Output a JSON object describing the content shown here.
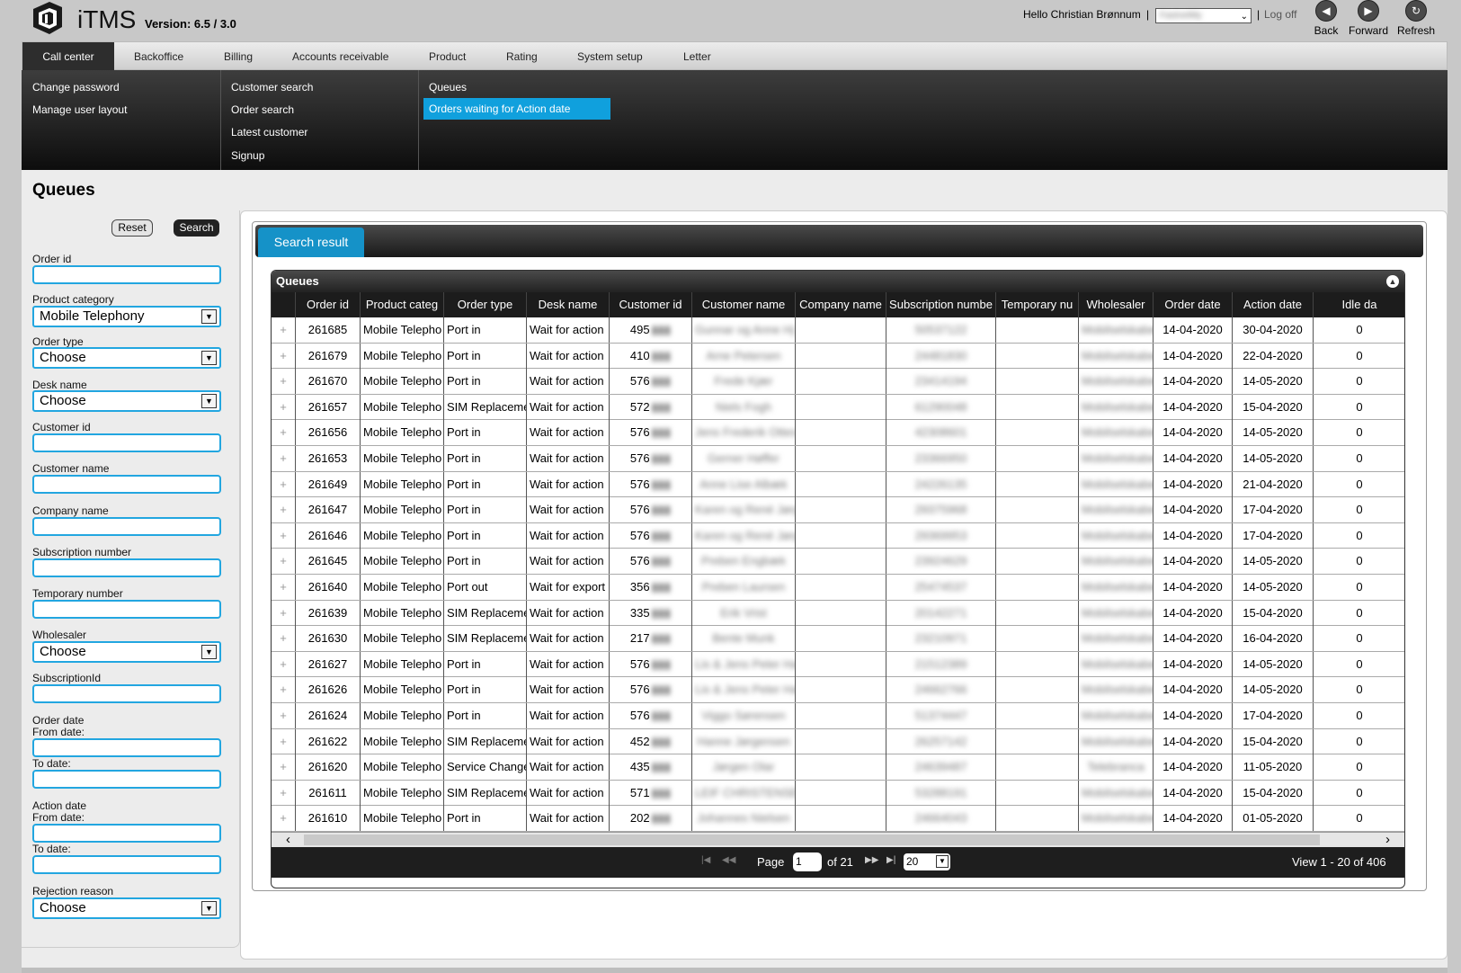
{
  "app": {
    "brand": "iTMS",
    "version": "Version: 6.5 / 3.0"
  },
  "header": {
    "greeting": "Hello Christian Brønnum",
    "separator": "|",
    "profile_value": "FastnetMy",
    "logoff": "Log off",
    "nav": [
      {
        "label": "Back",
        "icon": "back-icon",
        "glyph": "◀"
      },
      {
        "label": "Forward",
        "icon": "forward-icon",
        "glyph": "▶"
      },
      {
        "label": "Refresh",
        "icon": "refresh-icon",
        "glyph": "↻"
      }
    ]
  },
  "tabs": [
    "Call center",
    "Backoffice",
    "Billing",
    "Accounts receivable",
    "Product",
    "Rating",
    "System setup",
    "Letter"
  ],
  "submenu": {
    "col1": [
      "Change password",
      "Manage user layout"
    ],
    "col2": [
      "Customer search",
      "Order search",
      "Latest customer",
      "Signup"
    ],
    "col3": [
      "Queues",
      "Orders waiting for Action date"
    ]
  },
  "page_title": "Queues",
  "filters": {
    "reset": "Reset",
    "search": "Search",
    "order_id": "Order id",
    "product_category": "Product category",
    "product_category_value": "Mobile Telephony",
    "order_type": "Order type",
    "desk_name": "Desk name",
    "choose": "Choose",
    "customer_id": "Customer id",
    "customer_name": "Customer name",
    "company_name": "Company name",
    "subscription_number": "Subscription number",
    "temporary_number": "Temporary number",
    "wholesaler": "Wholesaler",
    "subscription_id": "SubscriptionId",
    "order_date": "Order date",
    "from_date": "From date:",
    "to_date": "To date:",
    "action_date": "Action date",
    "rejection_reason": "Rejection reason"
  },
  "result": {
    "tab": "Search result",
    "grid_caption": "Queues",
    "columns": [
      "",
      "Order id",
      "Product categ",
      "Order type",
      "Desk name",
      "Customer id",
      "Customer name",
      "Company name",
      "Subscription numbe",
      "Temporary nu",
      "Wholesaler",
      "Order date",
      "Action date",
      "Idle da"
    ],
    "rows": [
      [
        "+",
        "261685",
        "Mobile Telepho",
        "Port in",
        "Wait for action",
        "495",
        "Gunnar og Anne Hj",
        "",
        "50537122",
        "",
        "Mobilselskabet",
        "14-04-2020",
        "30-04-2020",
        "0"
      ],
      [
        "+",
        "261679",
        "Mobile Telepho",
        "Port in",
        "Wait for action",
        "410",
        "Arne Petersen",
        "",
        "24481830",
        "",
        "Mobilselskabet",
        "14-04-2020",
        "22-04-2020",
        "0"
      ],
      [
        "+",
        "261670",
        "Mobile Telepho",
        "Port in",
        "Wait for action",
        "576",
        "Frede Kjær",
        "",
        "23414194",
        "",
        "Mobilselskabet",
        "14-04-2020",
        "14-05-2020",
        "0"
      ],
      [
        "+",
        "261657",
        "Mobile Telepho",
        "SIM Replaceme",
        "Wait for action",
        "572",
        "Niels Fogh",
        "",
        "61290048",
        "",
        "Mobilselskabet",
        "14-04-2020",
        "15-04-2020",
        "0"
      ],
      [
        "+",
        "261656",
        "Mobile Telepho",
        "Port in",
        "Wait for action",
        "576",
        "Jens Frederik Ottes",
        "",
        "42308601",
        "",
        "Mobilselskabet",
        "14-04-2020",
        "14-05-2020",
        "0"
      ],
      [
        "+",
        "261653",
        "Mobile Telepho",
        "Port in",
        "Wait for action",
        "576",
        "Gerner Høffer",
        "",
        "23366950",
        "",
        "Mobilselskabet",
        "14-04-2020",
        "14-05-2020",
        "0"
      ],
      [
        "+",
        "261649",
        "Mobile Telepho",
        "Port in",
        "Wait for action",
        "576",
        "Anne Lise Albæk",
        "",
        "24226135",
        "",
        "Mobilselskabet",
        "14-04-2020",
        "21-04-2020",
        "0"
      ],
      [
        "+",
        "261647",
        "Mobile Telepho",
        "Port in",
        "Wait for action",
        "576",
        "Karen og René Jørg",
        "",
        "29375968",
        "",
        "Mobilselskabet",
        "14-04-2020",
        "17-04-2020",
        "0"
      ],
      [
        "+",
        "261646",
        "Mobile Telepho",
        "Port in",
        "Wait for action",
        "576",
        "Karen og René Jørg",
        "",
        "29369953",
        "",
        "Mobilselskabet",
        "14-04-2020",
        "17-04-2020",
        "0"
      ],
      [
        "+",
        "261645",
        "Mobile Telepho",
        "Port in",
        "Wait for action",
        "576",
        "Preben Engbæk",
        "",
        "23924629",
        "",
        "Mobilselskabet",
        "14-04-2020",
        "14-05-2020",
        "0"
      ],
      [
        "+",
        "261640",
        "Mobile Telepho",
        "Port out",
        "Wait for export",
        "356",
        "Preben Laursen",
        "",
        "25474537",
        "",
        "Mobilselskabet",
        "14-04-2020",
        "14-05-2020",
        "0"
      ],
      [
        "+",
        "261639",
        "Mobile Telepho",
        "SIM Replaceme",
        "Wait for action",
        "335",
        "Erik Vrist",
        "",
        "20142271",
        "",
        "Mobilselskabet",
        "14-04-2020",
        "15-04-2020",
        "0"
      ],
      [
        "+",
        "261630",
        "Mobile Telepho",
        "SIM Replaceme",
        "Wait for action",
        "217",
        "Bente Munk",
        "",
        "23210971",
        "",
        "Mobilselskabet",
        "14-04-2020",
        "16-04-2020",
        "0"
      ],
      [
        "+",
        "261627",
        "Mobile Telepho",
        "Port in",
        "Wait for action",
        "576",
        "Lis & Jens Peter Ha",
        "",
        "21512389",
        "",
        "Mobilselskabet",
        "14-04-2020",
        "14-05-2020",
        "0"
      ],
      [
        "+",
        "261626",
        "Mobile Telepho",
        "Port in",
        "Wait for action",
        "576",
        "Lis & Jens Peter Ha",
        "",
        "24662766",
        "",
        "Mobilselskabet",
        "14-04-2020",
        "14-05-2020",
        "0"
      ],
      [
        "+",
        "261624",
        "Mobile Telepho",
        "Port in",
        "Wait for action",
        "576",
        "Viggo Sørensen",
        "",
        "51374447",
        "",
        "Mobilselskabet",
        "14-04-2020",
        "17-04-2020",
        "0"
      ],
      [
        "+",
        "261622",
        "Mobile Telepho",
        "SIM Replaceme",
        "Wait for action",
        "452",
        "Hanne Jørgensen",
        "",
        "26257142",
        "",
        "Mobilselskabet",
        "14-04-2020",
        "15-04-2020",
        "0"
      ],
      [
        "+",
        "261620",
        "Mobile Telepho",
        "Service Change",
        "Wait for action",
        "435",
        "Jørgen Olar",
        "",
        "24639487",
        "",
        "Telebranca",
        "14-04-2020",
        "11-05-2020",
        "0"
      ],
      [
        "+",
        "261611",
        "Mobile Telepho",
        "SIM Replaceme",
        "Wait for action",
        "571",
        "LEIF CHRISTENSEN",
        "",
        "53288191",
        "",
        "Mobilselskabet",
        "14-04-2020",
        "15-04-2020",
        "0"
      ],
      [
        "+",
        "261610",
        "Mobile Telepho",
        "Port in",
        "Wait for action",
        "202",
        "Johannes Nielsen",
        "",
        "24664043",
        "",
        "Mobilselskabet",
        "14-04-2020",
        "01-05-2020",
        "0"
      ]
    ],
    "pager": {
      "page_label": "Page",
      "page_value": "1",
      "of_label": "of 21",
      "page_size": "20",
      "view": "View 1 - 20 of 406"
    }
  }
}
